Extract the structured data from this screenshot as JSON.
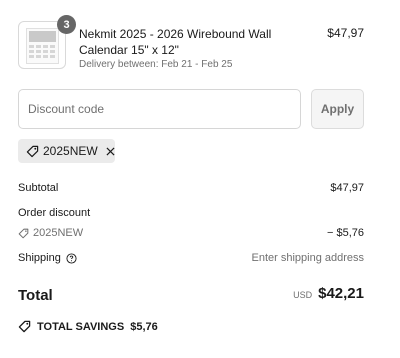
{
  "cart": {
    "quantity": "3",
    "item_name": "Nekmit 2025 - 2026 Wirebound Wall Calendar 15\" x 12\"",
    "delivery": "Delivery between: Feb 21 - Feb 25",
    "price": "$47,97"
  },
  "discount": {
    "placeholder": "Discount code",
    "apply_label": "Apply",
    "applied_code": "2025NEW"
  },
  "summary": {
    "subtotal_label": "Subtotal",
    "subtotal_value": "$47,97",
    "order_discount_label": "Order discount",
    "discount_code": "2025NEW",
    "discount_value": "− $5,76",
    "shipping_label": "Shipping",
    "shipping_value": "Enter shipping address",
    "total_label": "Total",
    "currency": "USD",
    "total_value": "$42,21",
    "savings_label": "TOTAL SAVINGS",
    "savings_value": "$5,76"
  },
  "icons": {
    "tag": "tag-icon",
    "close": "close-icon",
    "help": "help-circle-icon"
  },
  "colors": {
    "text": "#1a1a1a",
    "muted": "#707070",
    "chip_bg": "#ebebeb",
    "badge_bg": "#666666"
  }
}
